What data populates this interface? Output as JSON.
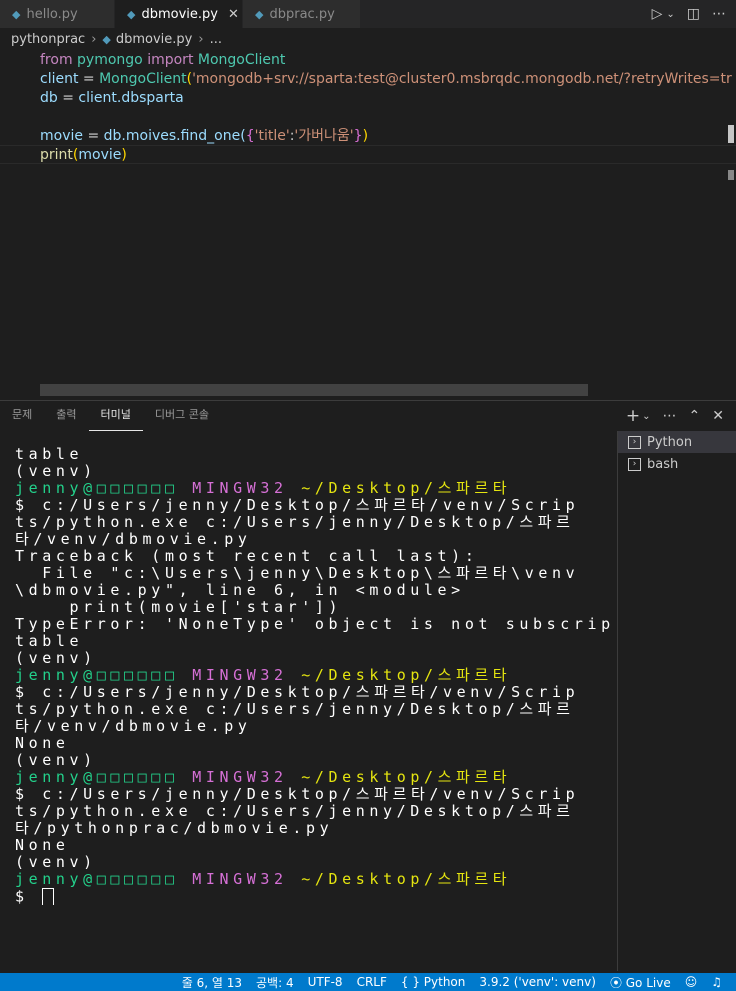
{
  "tabs": [
    {
      "label": "hello.py",
      "active": false
    },
    {
      "label": "dbmovie.py",
      "active": true
    },
    {
      "label": "dbprac.py",
      "active": false
    }
  ],
  "tab_close": "✕",
  "breadcrumb": {
    "folder": "pythonprac",
    "file": "dbmovie.py",
    "more": "..."
  },
  "code": {
    "l1": {
      "kw_from": "from",
      "mod": "pymongo",
      "kw_import": "import",
      "cls": "MongoClient"
    },
    "l2": {
      "var": "client",
      "eq": " = ",
      "cls": "MongoClient",
      "open": "(",
      "str": "'mongodb+srv://sparta:test@cluster0.msbrqdc.mongodb.net/?retryWrites=tr"
    },
    "l3": {
      "var": "db",
      "eq": " = ",
      "rest": "client.dbsparta"
    },
    "l5": {
      "var": "movie",
      "eq": " = ",
      "rest": "db.moives.find_one(",
      "ob": "{",
      "k": "'title'",
      "colon": ":",
      "v": "'가버나움'",
      "cb": "}",
      "cp": ")"
    },
    "l6": {
      "fn": "print",
      "op": "(",
      "arg": "movie",
      "cp": ")"
    }
  },
  "panel_tabs": [
    {
      "label": "문제",
      "active": false
    },
    {
      "label": "출력",
      "active": false
    },
    {
      "label": "터미널",
      "active": true
    },
    {
      "label": "디버그 콘솔",
      "active": false
    }
  ],
  "terminal": {
    "lines": [
      "table",
      "(venv)",
      {
        "user": "jenny@□□□□□□",
        "host": "MINGW32",
        "path": "~/Desktop/스파르타"
      },
      "$ c:/Users/jenny/Desktop/스파르타/venv/Scrip",
      "ts/python.exe c:/Users/jenny/Desktop/스파르",
      "타/venv/dbmovie.py",
      "Traceback (most recent call last):",
      "  File \"c:\\Users\\jenny\\Desktop\\스파르타\\venv",
      "\\dbmovie.py\", line 6, in <module>",
      "    print(movie['star'])",
      "TypeError: 'NoneType' object is not subscrip",
      "table",
      "(venv)",
      {
        "user": "jenny@□□□□□□",
        "host": "MINGW32",
        "path": "~/Desktop/스파르타"
      },
      "$ c:/Users/jenny/Desktop/스파르타/venv/Scrip",
      "ts/python.exe c:/Users/jenny/Desktop/스파르",
      "타/venv/dbmovie.py",
      "None",
      "(venv)",
      {
        "user": "jenny@□□□□□□",
        "host": "MINGW32",
        "path": "~/Desktop/스파르타"
      },
      "$ c:/Users/jenny/Desktop/스파르타/venv/Scrip",
      "ts/python.exe c:/Users/jenny/Desktop/스파르",
      "타/pythonprac/dbmovie.py",
      "None",
      "(venv)",
      {
        "user": "jenny@□□□□□□",
        "host": "MINGW32",
        "path": "~/Desktop/스파르타"
      }
    ],
    "prompt": "$ "
  },
  "terminal_list": [
    {
      "label": "Python",
      "active": true
    },
    {
      "label": "bash",
      "active": false
    }
  ],
  "statusbar": {
    "position": "줄 6, 열 13",
    "spaces": "공백: 4",
    "encoding": "UTF-8",
    "eol": "CRLF",
    "language": "{ } Python",
    "interpreter": "3.9.2 ('venv': venv)",
    "golive": "⦿ Go Live"
  },
  "colors": {
    "status_bg": "#007acc",
    "term_green": "#23d18b",
    "term_magenta": "#d670d6",
    "term_yellow": "#e5e510"
  }
}
